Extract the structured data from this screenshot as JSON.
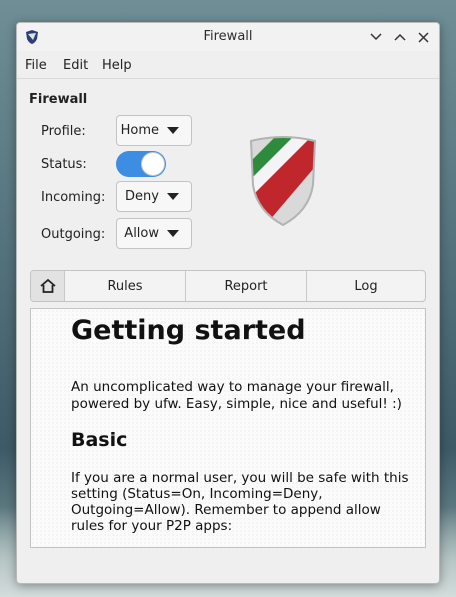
{
  "window": {
    "title": "Firewall"
  },
  "menubar": {
    "items": [
      "File",
      "Edit",
      "Help"
    ]
  },
  "panel": {
    "section_title": "Firewall",
    "profile": {
      "label": "Profile:",
      "value": "Home"
    },
    "status": {
      "label": "Status:",
      "on": true
    },
    "incoming": {
      "label": "Incoming:",
      "value": "Deny"
    },
    "outgoing": {
      "label": "Outgoing:",
      "value": "Allow"
    }
  },
  "tabs": [
    "Rules",
    "Report",
    "Log"
  ],
  "home_icon": "home-icon",
  "content": {
    "heading": "Getting started",
    "intro": "An uncomplicated way to manage your firewall, powered by ufw. Easy, simple, nice and useful! :)",
    "subheading": "Basic",
    "basic_text": "If you are a normal user, you will be safe with this setting (Status=On, Incoming=Deny, Outgoing=Allow). Remember to append allow rules for your P2P apps:"
  },
  "colors": {
    "toggle_on": "#3d8ee3",
    "shield_green": "#2e8b3e",
    "shield_red": "#c0272d"
  }
}
